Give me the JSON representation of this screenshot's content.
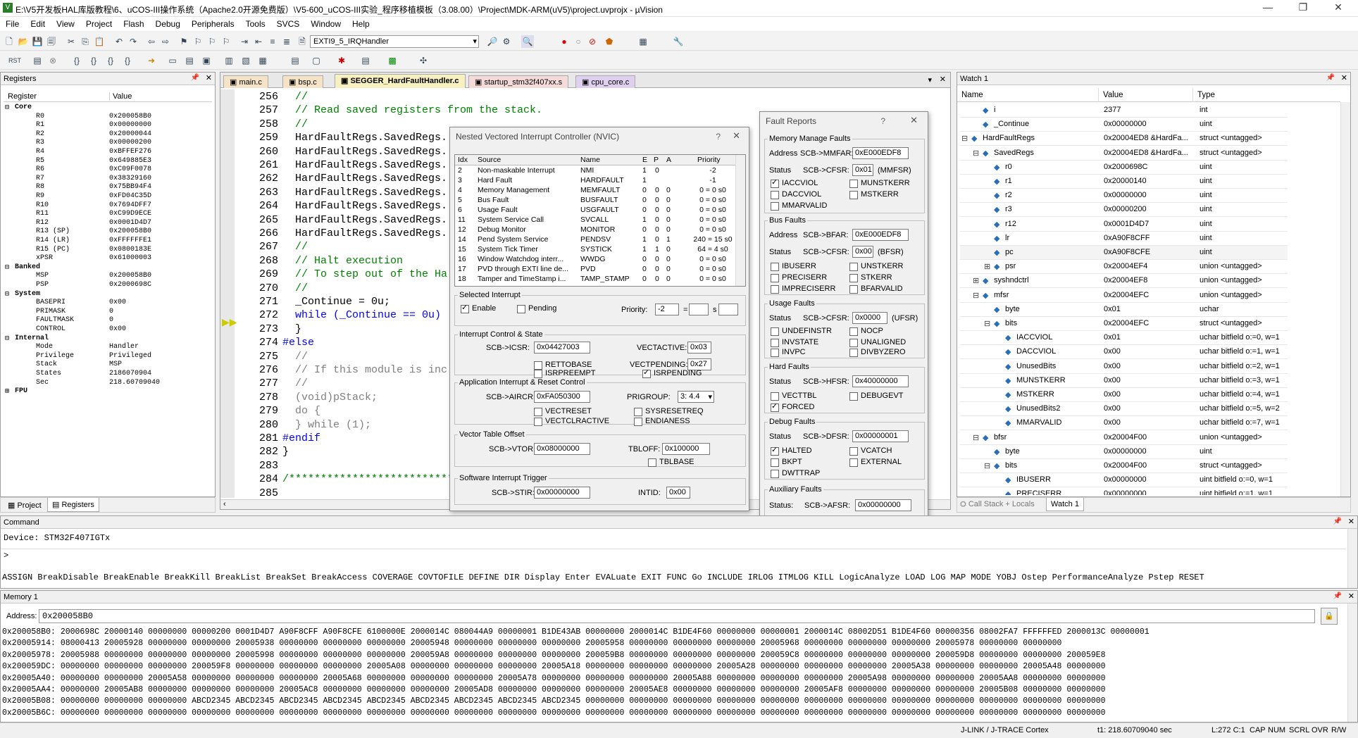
{
  "window": {
    "title": "E:\\V5开发板HAL库版教程\\6、uCOS-III操作系统（Apache2.0开源免费版）\\V5-600_uCOS-III实验_程序移植模板（3.08.00）\\Project\\MDK-ARM(uV5)\\project.uvprojx - µVision"
  },
  "menu": [
    "File",
    "Edit",
    "View",
    "Project",
    "Flash",
    "Debug",
    "Peripherals",
    "Tools",
    "SVCS",
    "Window",
    "Help"
  ],
  "toolbar": {
    "function_combo": "EXTI9_5_IRQHandler"
  },
  "registers": {
    "title": "Registers",
    "col_register": "Register",
    "col_value": "Value",
    "groups": {
      "core": "Core",
      "banked": "Banked",
      "system": "System",
      "internal": "Internal",
      "fpu": "FPU"
    },
    "core": [
      [
        "R0",
        "0x200058B0"
      ],
      [
        "R1",
        "0x00000000"
      ],
      [
        "R2",
        "0x20000044"
      ],
      [
        "R3",
        "0x00000200"
      ],
      [
        "R4",
        "0xBFFEF276"
      ],
      [
        "R5",
        "0x649885E3"
      ],
      [
        "R6",
        "0xC09F0078"
      ],
      [
        "R7",
        "0x38329160"
      ],
      [
        "R8",
        "0x75BB94F4"
      ],
      [
        "R9",
        "0xFD04C35D"
      ],
      [
        "R10",
        "0x7694DFF7"
      ],
      [
        "R11",
        "0xC99D9ECE"
      ],
      [
        "R12",
        "0x0001D4D7"
      ],
      [
        "R13 (SP)",
        "0x200058B0"
      ],
      [
        "R14 (LR)",
        "0xFFFFFFE1"
      ],
      [
        "R15 (PC)",
        "0x0800183E"
      ],
      [
        "xPSR",
        "0x61000003"
      ]
    ],
    "banked": [
      [
        "MSP",
        "0x200058B0"
      ],
      [
        "PSP",
        "0x2000698C"
      ]
    ],
    "system": [
      [
        "BASEPRI",
        "0x00"
      ],
      [
        "PRIMASK",
        "0"
      ],
      [
        "FAULTMASK",
        "0"
      ],
      [
        "CONTROL",
        "0x00"
      ]
    ],
    "internal": [
      [
        "Mode",
        "Handler"
      ],
      [
        "Privilege",
        "Privileged"
      ],
      [
        "Stack",
        "MSP"
      ],
      [
        "States",
        "2186070904"
      ],
      [
        "Sec",
        "218.60709040"
      ]
    ],
    "tab_project": "Project",
    "tab_registers": "Registers"
  },
  "editor": {
    "tabs": [
      "main.c",
      "bsp.c",
      "SEGGER_HardFaultHandler.c",
      "startup_stm32f407xx.s",
      "cpu_core.c"
    ],
    "lines": [
      {
        "n": "256",
        "t": "  //",
        "c": "cm"
      },
      {
        "n": "257",
        "t": "  // Read saved registers from the stack.",
        "c": "cm"
      },
      {
        "n": "258",
        "t": "  //",
        "c": "cm"
      },
      {
        "n": "259",
        "t": "  HardFaultRegs.SavedRegs.",
        "c": ""
      },
      {
        "n": "260",
        "t": "  HardFaultRegs.SavedRegs.",
        "c": ""
      },
      {
        "n": "261",
        "t": "  HardFaultRegs.SavedRegs.",
        "c": ""
      },
      {
        "n": "262",
        "t": "  HardFaultRegs.SavedRegs.",
        "c": ""
      },
      {
        "n": "263",
        "t": "  HardFaultRegs.SavedRegs.",
        "c": ""
      },
      {
        "n": "264",
        "t": "  HardFaultRegs.SavedRegs.",
        "c": ""
      },
      {
        "n": "265",
        "t": "  HardFaultRegs.SavedRegs.",
        "c": ""
      },
      {
        "n": "266",
        "t": "  HardFaultRegs.SavedRegs.",
        "c": ""
      },
      {
        "n": "267",
        "t": "  //",
        "c": "cm"
      },
      {
        "n": "268",
        "t": "  // Halt execution",
        "c": "cm"
      },
      {
        "n": "269",
        "t": "  // To step out of the Ha",
        "c": "cm"
      },
      {
        "n": "270",
        "t": "  //",
        "c": "cm"
      },
      {
        "n": "271",
        "t": "  _Continue = 0u;",
        "c": ""
      },
      {
        "n": "272",
        "t": "  while (_Continue == 0u)",
        "c": "kw"
      },
      {
        "n": "273",
        "t": "  }",
        "c": ""
      },
      {
        "n": "274",
        "t": "#else",
        "c": "kw"
      },
      {
        "n": "275",
        "t": "  //",
        "c": "pp"
      },
      {
        "n": "276",
        "t": "  // If this module is inc",
        "c": "pp"
      },
      {
        "n": "277",
        "t": "  //",
        "c": "pp"
      },
      {
        "n": "278",
        "t": "  (void)pStack;",
        "c": "pp"
      },
      {
        "n": "279",
        "t": "  do {",
        "c": "pp"
      },
      {
        "n": "280",
        "t": "  } while (1);",
        "c": "pp"
      },
      {
        "n": "281",
        "t": "#endif",
        "c": "kw"
      },
      {
        "n": "282",
        "t": "}",
        "c": ""
      },
      {
        "n": "283",
        "t": "",
        "c": ""
      },
      {
        "n": "284",
        "t": "/*****************************",
        "c": "cm"
      },
      {
        "n": "285",
        "t": "",
        "c": ""
      }
    ]
  },
  "nvic": {
    "title": "Nested Vectored Interrupt Controller (NVIC)",
    "headers": [
      "Idx",
      "Source",
      "Name",
      "E",
      "P",
      "A",
      "Priority"
    ],
    "rows": [
      [
        "2",
        "Non-maskable Interrupt",
        "NMI",
        "1",
        "0",
        "",
        "-2"
      ],
      [
        "3",
        "Hard Fault",
        "HARDFAULT",
        "1",
        "",
        "",
        "-1"
      ],
      [
        "4",
        "Memory Management",
        "MEMFAULT",
        "0",
        "0",
        "0",
        "0 = 0 s0"
      ],
      [
        "5",
        "Bus Fault",
        "BUSFAULT",
        "0",
        "0",
        "0",
        "0 = 0 s0"
      ],
      [
        "6",
        "Usage Fault",
        "USGFAULT",
        "0",
        "0",
        "0",
        "0 = 0 s0"
      ],
      [
        "11",
        "System Service Call",
        "SVCALL",
        "1",
        "0",
        "0",
        "0 = 0 s0"
      ],
      [
        "12",
        "Debug Monitor",
        "MONITOR",
        "0",
        "0",
        "0",
        "0 = 0 s0"
      ],
      [
        "14",
        "Pend System Service",
        "PENDSV",
        "1",
        "0",
        "1",
        "240 = 15 s0"
      ],
      [
        "15",
        "System Tick Timer",
        "SYSTICK",
        "1",
        "1",
        "0",
        "64 = 4 s0"
      ],
      [
        "16",
        "Window Watchdog interr...",
        "WWDG",
        "0",
        "0",
        "0",
        "0 = 0 s0"
      ],
      [
        "17",
        "PVD through EXTI line de...",
        "PVD",
        "0",
        "0",
        "0",
        "0 = 0 s0"
      ],
      [
        "18",
        "Tamper and TimeStamp i...",
        "TAMP_STAMP",
        "0",
        "0",
        "0",
        "0 = 0 s0"
      ]
    ],
    "sel_title": "Selected Interrupt",
    "enable": "Enable",
    "pending": "Pending",
    "priority_label": "Priority:",
    "priority_value": "-2",
    "ictrl_title": "Interrupt Control & State",
    "icsr_label": "SCB->ICSR:",
    "icsr": "0x04427003",
    "vectactive_label": "VECTACTIVE:",
    "vectactive": "0x03",
    "rettobase": "RETTOBASE",
    "vectpending_label": "VECTPENDING:",
    "vectpending": "0x27",
    "isrpreempt": "ISRPREEMPT",
    "isrpending": "ISRPENDING",
    "aircr_title": "Application Interrupt & Reset Control",
    "aircr_label": "SCB->AIRCR:",
    "aircr": "0xFA050300",
    "prigroup_label": "PRIGROUP:",
    "prigroup": "3: 4.4",
    "vectreset": "VECTRESET",
    "sysresetreq": "SYSRESETREQ",
    "vectclractive": "VECTCLRACTIVE",
    "endianess": "ENDIANESS",
    "vto_title": "Vector Table Offset",
    "vtor_label": "SCB->VTOR:",
    "vtor": "0x08000000",
    "tbloff_label": "TBLOFF:",
    "tbloff": "0x100000",
    "tblbase": "TBLBASE",
    "swt_title": "Software Interrupt Trigger",
    "stir_label": "SCB->STIR:",
    "stir": "0x00000000",
    "intid_label": "INTID:",
    "intid": "0x00"
  },
  "fault": {
    "title": "Fault Reports",
    "mm_title": "Memory Manage Faults",
    "address": "Address",
    "mmfar_label": "SCB->MMFAR:",
    "mmfar": "0xE000EDF8",
    "status": "Status",
    "cfsr_label": "SCB->CFSR:",
    "mmfsr": "0x01",
    "mmfsr_tag": "(MMFSR)",
    "iaccviol": "IACCVIOL",
    "munstkerr": "MUNSTKERR",
    "daccviol": "DACCVIOL",
    "mstkerr": "MSTKERR",
    "mmarvalid": "MMARVALID",
    "bf_title": "Bus Faults",
    "bfar_label": "SCB->BFAR:",
    "bfar": "0xE000EDF8",
    "bfsr": "0x00",
    "bfsr_tag": "(BFSR)",
    "ibuserr": "IBUSERR",
    "unstkerr": "UNSTKERR",
    "preciserr": "PRECISERR",
    "stkerr": "STKERR",
    "impreciserr": "IMPRECISERR",
    "bfarvalid": "BFARVALID",
    "uf_title": "Usage Faults",
    "ufsr": "0x0000",
    "ufsr_tag": "(UFSR)",
    "undefinstr": "UNDEFINSTR",
    "nocp": "NOCP",
    "invstate": "INVSTATE",
    "unaligned": "UNALIGNED",
    "invpc": "INVPC",
    "divbyzero": "DIVBYZERO",
    "hf_title": "Hard Faults",
    "hfsr_label": "SCB->HFSR:",
    "hfsr": "0x40000000",
    "vecttbl": "VECTTBL",
    "debugevt": "DEBUGEVT",
    "forced": "FORCED",
    "df_title": "Debug Faults",
    "dfsr_label": "SCB->DFSR:",
    "dfsr": "0x00000001",
    "halted": "HALTED",
    "vcatch": "VCATCH",
    "bkpt": "BKPT",
    "external": "EXTERNAL",
    "dwttrap": "DWTTRAP",
    "af_title": "Auxiliary Faults",
    "afsr_status": "Status:",
    "afsr_label": "SCB->AFSR:",
    "afsr": "0x00000000"
  },
  "watch": {
    "title": "Watch 1",
    "col_name": "Name",
    "col_value": "Value",
    "col_type": "Type",
    "rows": [
      [
        "i",
        "2377",
        "int",
        1
      ],
      [
        "_Continue",
        "0x00000000",
        "uint",
        1
      ],
      [
        "HardFaultRegs",
        "0x20004ED8 &HardFa...",
        "struct <untagged>",
        0
      ],
      [
        "SavedRegs",
        "0x20004ED8 &HardFa...",
        "struct <untagged>",
        1
      ],
      [
        "r0",
        "0x2000698C",
        "uint",
        2
      ],
      [
        "r1",
        "0x20000140",
        "uint",
        2
      ],
      [
        "r2",
        "0x00000000",
        "uint",
        2
      ],
      [
        "r3",
        "0x00000200",
        "uint",
        2
      ],
      [
        "r12",
        "0x0001D4D7",
        "uint",
        2
      ],
      [
        "lr",
        "0xA90F8CFF",
        "uint",
        2
      ],
      [
        "pc",
        "0xA90F8CFE",
        "uint",
        2
      ],
      [
        "psr",
        "0x20004EF4",
        "union <untagged>",
        2
      ],
      [
        "syshndctrl",
        "0x20004EF8",
        "union <untagged>",
        1
      ],
      [
        "mfsr",
        "0x20004EFC",
        "union <untagged>",
        1
      ],
      [
        "byte",
        "0x01",
        "uchar",
        2
      ],
      [
        "bits",
        "0x20004EFC",
        "struct <untagged>",
        2
      ],
      [
        "IACCVIOL",
        "0x01",
        "uchar bitfield o:=0, w=1",
        3
      ],
      [
        "DACCVIOL",
        "0x00",
        "uchar bitfield o:=1, w=1",
        3
      ],
      [
        "UnusedBits",
        "0x00",
        "uchar bitfield o:=2, w=1",
        3
      ],
      [
        "MUNSTKERR",
        "0x00",
        "uchar bitfield o:=3, w=1",
        3
      ],
      [
        "MSTKERR",
        "0x00",
        "uchar bitfield o:=4, w=1",
        3
      ],
      [
        "UnusedBits2",
        "0x00",
        "uchar bitfield o:=5, w=2",
        3
      ],
      [
        "MMARVALID",
        "0x00",
        "uchar bitfield o:=7, w=1",
        3
      ],
      [
        "bfsr",
        "0x20004F00",
        "union <untagged>",
        1
      ],
      [
        "byte",
        "0x00000000",
        "uint",
        2
      ],
      [
        "bits",
        "0x20004F00",
        "struct <untagged>",
        2
      ],
      [
        "IBUSERR",
        "0x00000000",
        "uint bitfield o:=0, w=1",
        3
      ],
      [
        "PRECISERR",
        "0x00000000",
        "uint bitfield o:=1, w=1",
        3
      ]
    ],
    "tab_callstack": "Call Stack + Locals",
    "tab_watch": "Watch 1"
  },
  "command": {
    "title": "Command",
    "output": "Device: STM32F407IGTx",
    "prompt": ">",
    "keywords": "ASSIGN BreakDisable BreakEnable BreakKill BreakList BreakSet BreakAccess COVERAGE COVTOFILE DEFINE DIR Display Enter EVALuate EXIT FUNC Go INCLUDE IRLOG ITMLOG KILL LogicAnalyze LOAD LOG MAP MODE YOBJ Ostep PerformanceAnalyze Pstep RESET"
  },
  "memory": {
    "title": "Memory 1",
    "address_label": "Address:",
    "address": "0x200058B0",
    "rows": [
      "0x200058B0: 2000698C 20000140 00000000 00000200 0001D4D7 A90F8CFF A90F8CFE 6100000E 2000014C 080044A9 00000001 B1DE43AB 00000000 2000014C B1DE4F60 00000000 00000001 2000014C 08002D51 B1DE4F60 00000356 08002FA7 FFFFFFED 2000013C 00000001",
      "0x20005914: 08000413 20005928 00000000 00000000 20005938 00000000 00000000 00000000 20005948 00000000 00000000 00000000 20005958 00000000 00000000 00000000 20005968 00000000 00000000 00000000 20005978 00000000 00000000",
      "0x20005978: 20005988 00000000 00000000 00000000 20005998 00000000 00000000 00000000 200059A8 00000000 00000000 00000000 200059B8 00000000 00000000 00000000 200059C8 00000000 00000000 00000000 200059D8 00000000 00000000 200059E8",
      "0x200059DC: 00000000 00000000 00000000 200059F8 00000000 00000000 00000000 20005A08 00000000 00000000 00000000 20005A18 00000000 00000000 00000000 20005A28 00000000 00000000 00000000 20005A38 00000000 00000000 20005A48 00000000",
      "0x20005A40: 00000000 00000000 20005A58 00000000 00000000 00000000 20005A68 00000000 00000000 00000000 20005A78 00000000 00000000 00000000 20005A88 00000000 00000000 00000000 20005A98 00000000 00000000 20005AA8 00000000 00000000",
      "0x20005AA4: 00000000 20005AB8 00000000 00000000 00000000 20005AC8 00000000 00000000 00000000 20005AD8 00000000 00000000 00000000 20005AE8 00000000 00000000 00000000 20005AF8 00000000 00000000 00000000 20005B08 00000000 00000000",
      "0x20005B08: 00000000 00000000 00000000 ABCD2345 ABCD2345 ABCD2345 ABCD2345 ABCD2345 ABCD2345 ABCD2345 ABCD2345 ABCD2345 00000000 00000000 00000000 00000000 00000000 00000000 00000000 00000000 00000000 00000000 00000000 00000000",
      "0x20005B6C: 00000000 00000000 00000000 00000000 00000000 00000000 00000000 00000000 00000000 00000000 00000000 00000000 00000000 00000000 00000000 00000000 00000000 00000000 00000000 00000000 00000000 00000000 00000000 00000000"
    ]
  },
  "statusbar": {
    "debugger": "J-LINK / J-TRACE Cortex",
    "time": "t1: 218.60709040 sec",
    "pos": "L:272 C:1",
    "caps": "CAP",
    "num": "NUM",
    "scrl": "SCRL",
    "ovr": "OVR",
    "rw": "R/W"
  }
}
